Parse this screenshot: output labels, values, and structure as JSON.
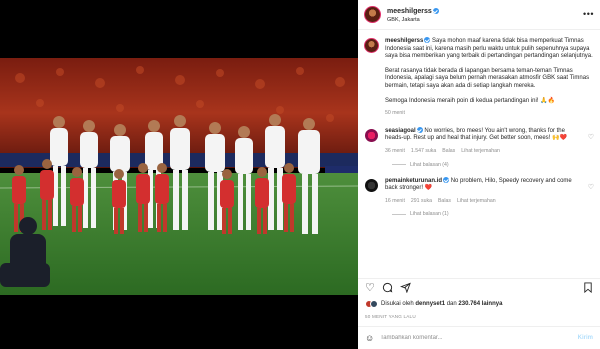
{
  "post": {
    "username": "meeshilgerss",
    "location": "GBK, Jakarta",
    "more_icon": "more-horizontal-icon"
  },
  "caption": {
    "username": "meeshilgerss",
    "p1": "Saya mohon maaf karena tidak bisa memperkuat Timnas Indonesia saat ini, karena masih perlu waktu untuk pulih sepenuhnya supaya saya bisa memberikan yang terbaik di pertandingan pertandingan selanjutnya.",
    "p2": "Berat rasanya tidak berada di lapangan bersama teman-teman Timnas Indonesia, apalagi saya belum pernah merasakan atmosfir GBK saat Timnas bermain, tetapi saya akan ada di setiap langkah mereka.",
    "p3": "Semoga Indonesia meraih poin di kedua pertandingan ini! 🙏🔥",
    "time": "50 menit"
  },
  "comments": [
    {
      "username": "seasiagoal",
      "text": "No worries, bro mees! You ain't wrong, thanks for the heads-up. Rest up and heal that injury. Get better soon, mees! 🙌❤️",
      "time": "36 menit",
      "likes": "1.547 suka",
      "reply": "Balas",
      "translate": "Lihat terjemahan",
      "view_replies": "Lihat balasan (4)"
    },
    {
      "username": "pemainketurunan.id",
      "text": "No problem, Hilo, Speedy recovery and come back stronger! ❤️",
      "time": "16 menit",
      "likes": "291 suka",
      "reply": "Balas",
      "translate": "Lihat terjemahan",
      "view_replies": "Lihat balasan (1)"
    }
  ],
  "actions": {
    "like_icon": "heart-icon",
    "comment_icon": "comment-icon",
    "share_icon": "send-icon",
    "save_icon": "bookmark-icon"
  },
  "likes": {
    "prefix": "Disukai oleh",
    "user": "dennyset1",
    "middle": "dan",
    "count": "230.764 lainnya"
  },
  "timestamp": "50 MENIT YANG LALU",
  "add_comment": {
    "placeholder": "Tambahkan komentar...",
    "post_label": "Kirim"
  },
  "colors": {
    "verified": "#3897f0",
    "jersey": "#ffffff",
    "kids_jersey": "#d32f2f",
    "pitch": "#3a7d2e"
  }
}
